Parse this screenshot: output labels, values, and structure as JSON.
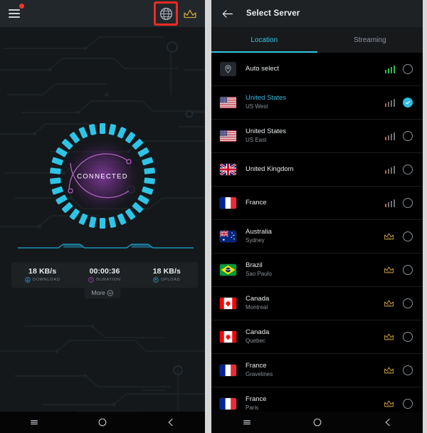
{
  "left_phone": {
    "appbar": {
      "menu_icon": "hamburger-menu-icon",
      "notification_dot": true,
      "globe_icon": "globe-icon",
      "crown_icon": "crown-icon",
      "highlight_color": "#ef2a22"
    },
    "status": {
      "label": "CONNECTED",
      "ring_color": "#2ec4e6",
      "arc_color": "#b361c6"
    },
    "stats": [
      {
        "value": "18 KB/s",
        "label": "DOWNLOAD",
        "icon": "download-arrow-icon",
        "icon_color": "#2a9dd4"
      },
      {
        "value": "00:00:36",
        "label": "DURATION",
        "icon": "clock-icon",
        "icon_color": "#a33fbf"
      },
      {
        "value": "18 KB/s",
        "label": "UPLOAD",
        "icon": "upload-arrow-icon",
        "icon_color": "#1fa0b5"
      }
    ],
    "more_label": "More",
    "navbar": {
      "recent": "recent-apps-icon",
      "home": "home-icon",
      "back": "back-icon"
    }
  },
  "right_phone": {
    "appbar": {
      "back_icon": "back-arrow-icon",
      "title": "Select Server"
    },
    "tabs": [
      {
        "label": "Location",
        "active": true
      },
      {
        "label": "Streaming",
        "active": false
      }
    ],
    "accent_color": "#2fc5e6",
    "servers": [
      {
        "name": "Auto select",
        "sub": "",
        "flag": "auto",
        "signal": "green",
        "selected": false,
        "pro": false
      },
      {
        "name": "United States",
        "sub": "US West",
        "flag": "us",
        "signal": "weak",
        "selected": true,
        "pro": false
      },
      {
        "name": "United States",
        "sub": "US East",
        "flag": "us",
        "signal": "weak",
        "selected": false,
        "pro": false
      },
      {
        "name": "United Kingdom",
        "sub": "",
        "flag": "uk",
        "signal": "weak",
        "selected": false,
        "pro": false
      },
      {
        "name": "France",
        "sub": "",
        "flag": "fr",
        "signal": "weak",
        "selected": false,
        "pro": false
      },
      {
        "name": "Australia",
        "sub": "Sydney",
        "flag": "au",
        "signal": "",
        "selected": false,
        "pro": true
      },
      {
        "name": "Brazil",
        "sub": "Sao Paulo",
        "flag": "br",
        "signal": "",
        "selected": false,
        "pro": true
      },
      {
        "name": "Canada",
        "sub": "Montreal",
        "flag": "ca",
        "signal": "",
        "selected": false,
        "pro": true
      },
      {
        "name": "Canada",
        "sub": "Quebec",
        "flag": "ca",
        "signal": "",
        "selected": false,
        "pro": true
      },
      {
        "name": "France",
        "sub": "Gravelines",
        "flag": "fr",
        "signal": "",
        "selected": false,
        "pro": true
      },
      {
        "name": "France",
        "sub": "Paris",
        "flag": "fr",
        "signal": "",
        "selected": false,
        "pro": true
      }
    ],
    "pro_badge_label": "Pro",
    "navbar": {
      "recent": "recent-apps-icon",
      "home": "home-icon",
      "back": "back-icon"
    }
  }
}
